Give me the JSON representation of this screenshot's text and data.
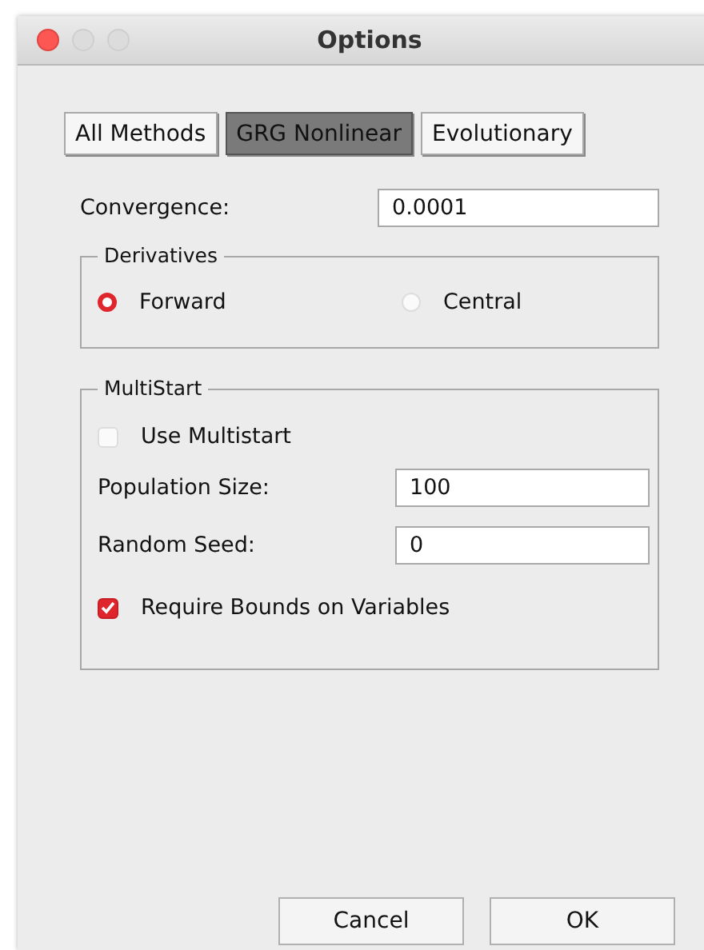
{
  "window": {
    "title": "Options"
  },
  "tabs": [
    {
      "label": "All Methods",
      "selected": false
    },
    {
      "label": "GRG Nonlinear",
      "selected": true
    },
    {
      "label": "Evolutionary",
      "selected": false
    }
  ],
  "convergence": {
    "label": "Convergence:",
    "value": "0.0001"
  },
  "derivatives": {
    "title": "Derivatives",
    "options": [
      {
        "label": "Forward",
        "selected": true
      },
      {
        "label": "Central",
        "selected": false
      }
    ]
  },
  "multistart": {
    "title": "MultiStart",
    "use_multistart": {
      "label": "Use Multistart",
      "checked": false
    },
    "fields": [
      {
        "label": "Population Size:",
        "value": "100"
      },
      {
        "label": "Random Seed:",
        "value": "0"
      }
    ],
    "require_bounds": {
      "label": "Require Bounds on Variables",
      "checked": true
    }
  },
  "buttons": [
    "Cancel",
    "OK"
  ]
}
